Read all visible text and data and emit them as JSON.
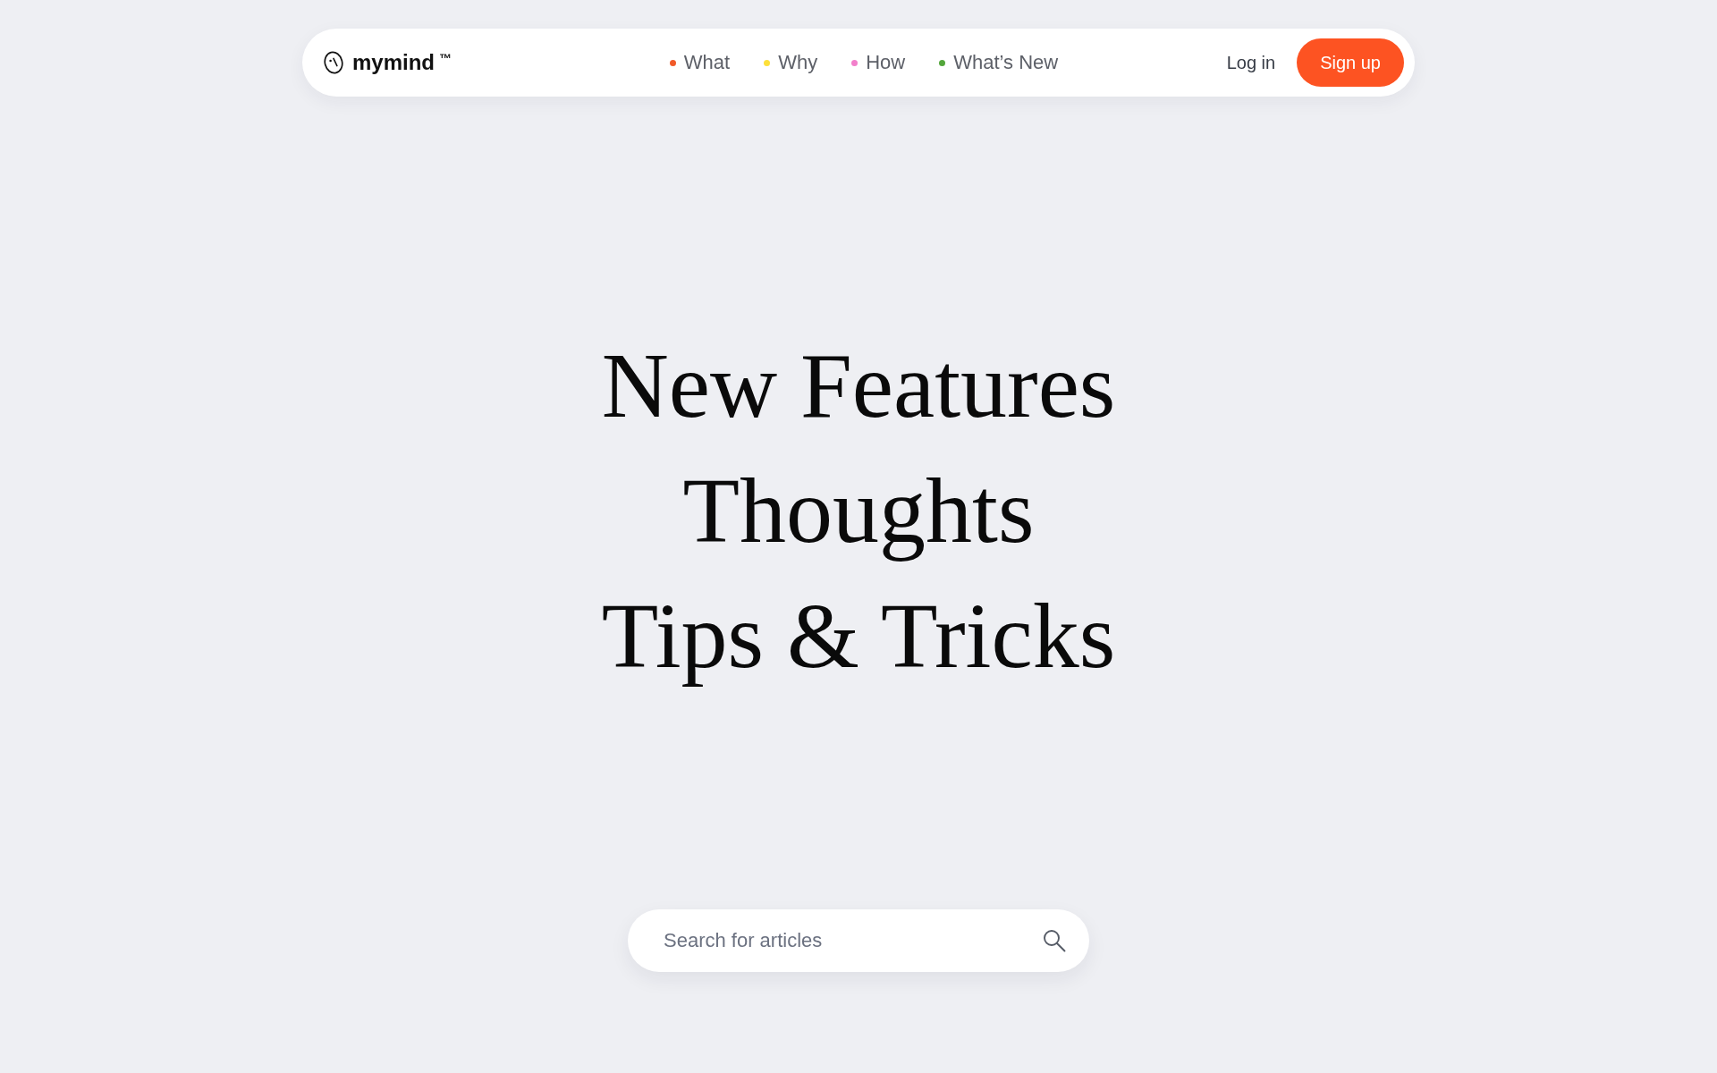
{
  "nav": {
    "logo": {
      "name": "mymind",
      "trademark": "™"
    },
    "links": [
      {
        "label": "What",
        "color": "#f15a29"
      },
      {
        "label": "Why",
        "color": "#fde03a"
      },
      {
        "label": "How",
        "color": "#f27fcb"
      },
      {
        "label": "What’s New",
        "color": "#53a63b"
      }
    ],
    "login": "Log in",
    "signup": "Sign up"
  },
  "hero": {
    "lines": [
      "New Features",
      "Thoughts",
      "Tips & Tricks"
    ]
  },
  "search": {
    "placeholder": "Search for articles"
  }
}
